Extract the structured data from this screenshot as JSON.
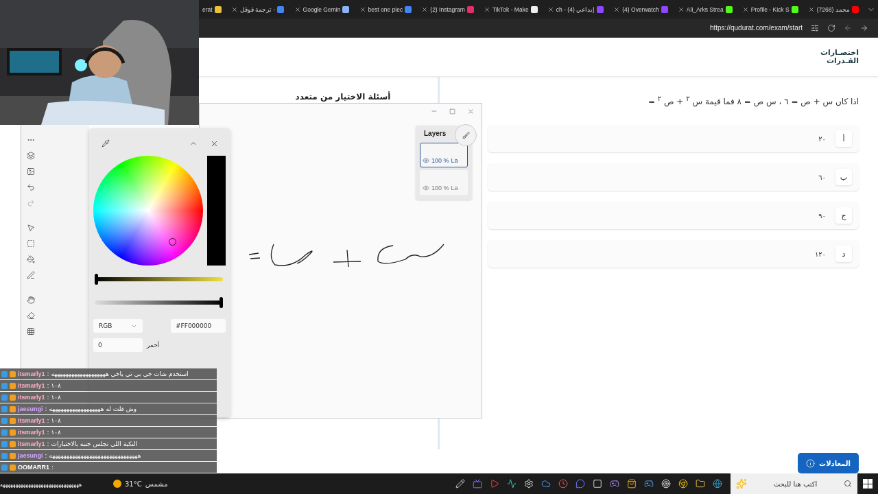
{
  "browser": {
    "tabs": [
      {
        "title": "(7268) محمد",
        "kind": "youtube",
        "closable": true
      },
      {
        "title": "Profile - Kick S",
        "kind": "kick",
        "closable": true
      },
      {
        "title": "Ali_Arks Strea",
        "kind": "kick",
        "closable": true
      },
      {
        "title": "(4) Overwatch",
        "kind": "twitch",
        "closable": true
      },
      {
        "title": "ch - إبداعي (4)",
        "kind": "twitch",
        "closable": true
      },
      {
        "title": "TikTok - Make",
        "kind": "tiktok",
        "closable": true
      },
      {
        "title": "(2) Instagram",
        "kind": "instagram",
        "closable": true
      },
      {
        "title": "best one piec",
        "kind": "google",
        "closable": true
      },
      {
        "title": "Google Gemin",
        "kind": "gemini",
        "closable": true
      },
      {
        "title": "ترجمة قوقل -",
        "kind": "google",
        "closable": true
      },
      {
        "title": "erat",
        "kind": "warning",
        "closable": false
      }
    ],
    "url": "https://qudurat.com/exam/start"
  },
  "site": {
    "logo_top": "اختصـارات",
    "logo_bottom": "القـدرات",
    "section_title": "أسئلة الاختيار من متعدد",
    "question": "اذا كان س + ص = ٦ ، س ص = ٨ فما قيمة س $^{٢}$ + ص $^{٢}$ =",
    "options": [
      {
        "letter": "أ",
        "value": "٢٠"
      },
      {
        "letter": "ب",
        "value": "٦٠"
      },
      {
        "letter": "ج",
        "value": "٩٠"
      },
      {
        "letter": "د",
        "value": "١٢٠"
      }
    ],
    "equations_button": "المعادلات"
  },
  "paint": {
    "layers_title": "Layers",
    "layers": [
      {
        "opacity": "100 %",
        "name": "La",
        "selected": true
      },
      {
        "opacity": "100 %",
        "name": "La",
        "selected": false
      }
    ],
    "color_picker": {
      "sliders": [
        {
          "kind": "brightness",
          "level": 0
        },
        {
          "kind": "alpha",
          "level": 1
        }
      ],
      "mode": "RGB",
      "hex": "#FF000000",
      "red_value": "0",
      "red_label": "أحمر"
    }
  },
  "chat": [
    {
      "user": "itsmarly1",
      "message": ": استخدم شات جي بي تي ياخي هههههههههههههههههههه",
      "color": "#ffb0c4"
    },
    {
      "user": "itsmarly1",
      "message": ": ١٠٨",
      "color": "#ffb0c4"
    },
    {
      "user": "itsmarly1",
      "message": ": ١٠٨",
      "color": "#ffb0c4"
    },
    {
      "user": "jaesungi",
      "message": ": وش قلت له ههههههههههههههههههه",
      "color": "#d9a6ff"
    },
    {
      "user": "itsmarly1",
      "message": ": ١٠٨",
      "color": "#ffb0c4"
    },
    {
      "user": "itsmarly1",
      "message": ": ١٠٨",
      "color": "#ffb0c4"
    },
    {
      "user": "itsmarly1",
      "message": ": النكبة اللي تجلس جنبه بالاختبارات",
      "color": "#ffb0c4"
    },
    {
      "user": "jaesungi",
      "message": ": هههههههههههههههههههههههههههههههه",
      "color": "#d9a6ff"
    },
    {
      "user": "OOMARR1",
      "message": ":",
      "color": "#ffffff"
    }
  ],
  "chat_overflow": "هههههههههههههههههههههههههههههههه",
  "taskbar": {
    "search_placeholder": "اكتب هنا للبحث",
    "temperature": "31°C",
    "weather": "مشمس"
  }
}
